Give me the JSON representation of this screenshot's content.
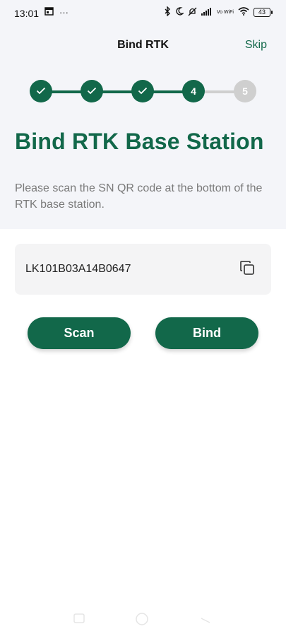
{
  "status_bar": {
    "time": "13:01",
    "more": "···",
    "network": "Vo WiFi",
    "battery": "43"
  },
  "header": {
    "title": "Bind RTK",
    "skip_label": "Skip"
  },
  "stepper": {
    "steps": [
      {
        "label": "",
        "state": "done"
      },
      {
        "label": "",
        "state": "done"
      },
      {
        "label": "",
        "state": "done"
      },
      {
        "label": "4",
        "state": "active"
      },
      {
        "label": "5",
        "state": "pending"
      }
    ],
    "current_step": 4,
    "total_steps": 5
  },
  "main": {
    "title": "Bind RTK Base Station",
    "description": "Please scan the SN QR code at the bottom of the RTK base station."
  },
  "sn_field": {
    "value": "LK101B03A14B0647"
  },
  "buttons": {
    "scan_label": "Scan",
    "bind_label": "Bind"
  },
  "colors": {
    "brand_green": "#12684a",
    "pending_gray": "#cfcfcf",
    "top_background": "#f4f5f9",
    "field_background": "#f4f4f5",
    "description_text": "#7a7a7a"
  },
  "icons": {
    "done_step": "check-icon",
    "copy": "copy-icon"
  }
}
